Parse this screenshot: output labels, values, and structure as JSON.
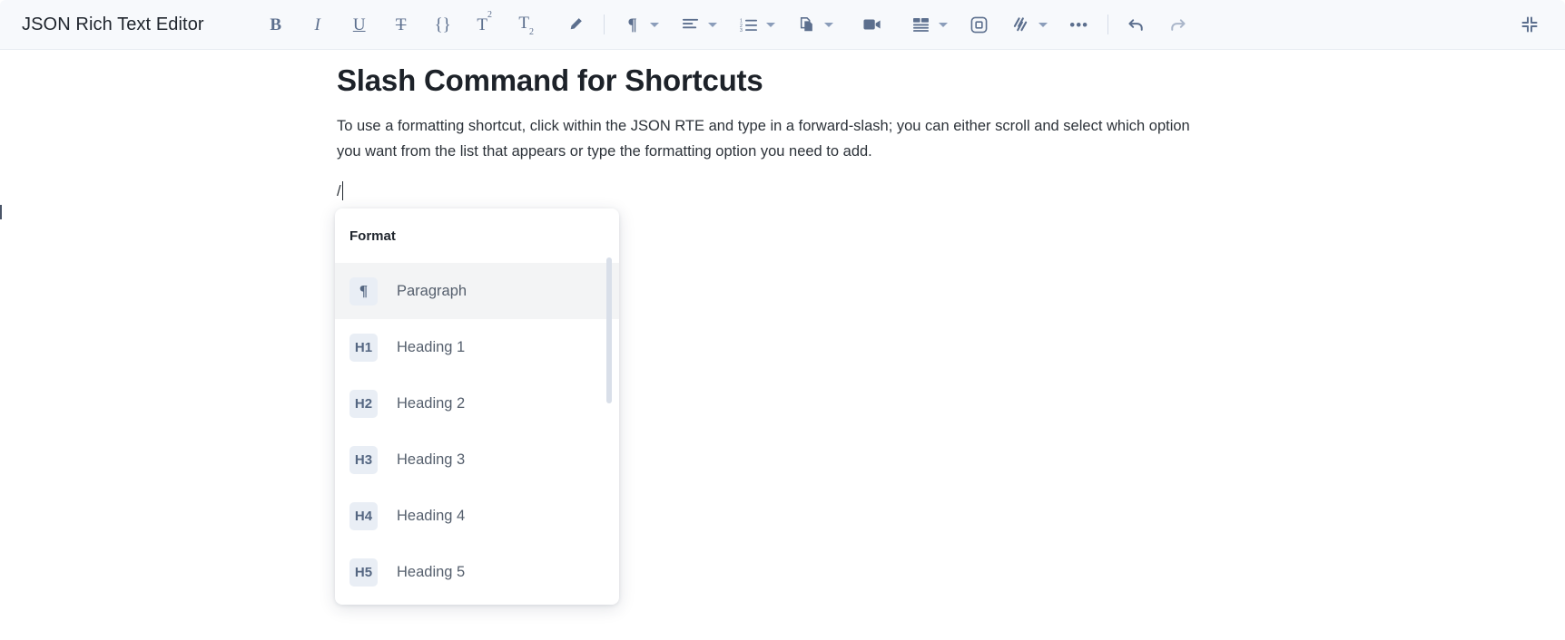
{
  "app": {
    "title": "JSON Rich Text Editor"
  },
  "toolbar": {
    "items": [
      {
        "name": "bold-icon",
        "label": "B",
        "kind": "serif-bold"
      },
      {
        "name": "italic-icon",
        "label": "I",
        "kind": "serif-italic"
      },
      {
        "name": "underline-icon",
        "label": "U",
        "kind": "serif-underline"
      },
      {
        "name": "strikethrough-icon",
        "label": "T",
        "kind": "serif-strike"
      },
      {
        "name": "code-icon",
        "label": "{}",
        "kind": "serif"
      },
      {
        "name": "superscript-icon",
        "label": "T2",
        "kind": "superscript"
      },
      {
        "name": "subscript-icon",
        "label": "T2",
        "kind": "subscript"
      },
      {
        "name": "highlight-pen-icon",
        "label": "",
        "kind": "svg-pen"
      },
      {
        "name": "paragraph-format-icon",
        "label": "¶",
        "kind": "serif",
        "caret": true
      },
      {
        "name": "text-align-icon",
        "label": "",
        "kind": "svg-align",
        "caret": true
      },
      {
        "name": "ordered-list-icon",
        "label": "",
        "kind": "svg-numlist",
        "caret": true
      },
      {
        "name": "copy-paste-icon",
        "label": "",
        "kind": "svg-copy",
        "caret": true
      },
      {
        "name": "video-icon",
        "label": "",
        "kind": "svg-video"
      },
      {
        "name": "table-icon",
        "label": "",
        "kind": "svg-table",
        "caret": true
      },
      {
        "name": "embed-icon",
        "label": "",
        "kind": "svg-embed"
      },
      {
        "name": "link-slash-icon",
        "label": "",
        "kind": "svg-slashes",
        "caret": true
      },
      {
        "name": "more-options-icon",
        "label": "•••",
        "kind": "dots"
      },
      {
        "name": "undo-icon",
        "label": "",
        "kind": "svg-undo"
      },
      {
        "name": "redo-icon",
        "label": "",
        "kind": "svg-redo",
        "dim": true
      },
      {
        "name": "collapse-fullscreen-icon",
        "label": "",
        "kind": "svg-collapse"
      }
    ],
    "labels": {
      "bold": "B",
      "italic": "I",
      "underline": "U",
      "strikethrough": "T",
      "code": "{}",
      "superscript_base": "T",
      "superscript_exp": "2",
      "subscript_base": "T",
      "subscript_exp": "2",
      "pilcrow": "¶",
      "more": "•••"
    }
  },
  "document": {
    "title": "Slash Command for Shortcuts",
    "paragraph": "To use a formatting shortcut, click within the JSON RTE and type in a forward-slash; you can either scroll and select which option you want from the list that appears or type the formatting option you need to add.",
    "slash_text": "/"
  },
  "slash_menu": {
    "header": "Format",
    "items": [
      {
        "badge": "¶",
        "label": "Paragraph",
        "active": true
      },
      {
        "badge": "H1",
        "label": "Heading 1",
        "active": false
      },
      {
        "badge": "H2",
        "label": "Heading 2",
        "active": false
      },
      {
        "badge": "H3",
        "label": "Heading 3",
        "active": false
      },
      {
        "badge": "H4",
        "label": "Heading 4",
        "active": false
      },
      {
        "badge": "H5",
        "label": "Heading 5",
        "active": false
      }
    ]
  },
  "colors": {
    "toolbar_bg": "#f7f9fc",
    "icon": "#5c6f8e",
    "icon_dim": "#aab6ca",
    "badge_bg": "#e9eef5",
    "badge_text": "#556782",
    "active_row": "#f3f4f5",
    "scrollbar": "#d9dfe9",
    "title_text": "#1d2229"
  }
}
